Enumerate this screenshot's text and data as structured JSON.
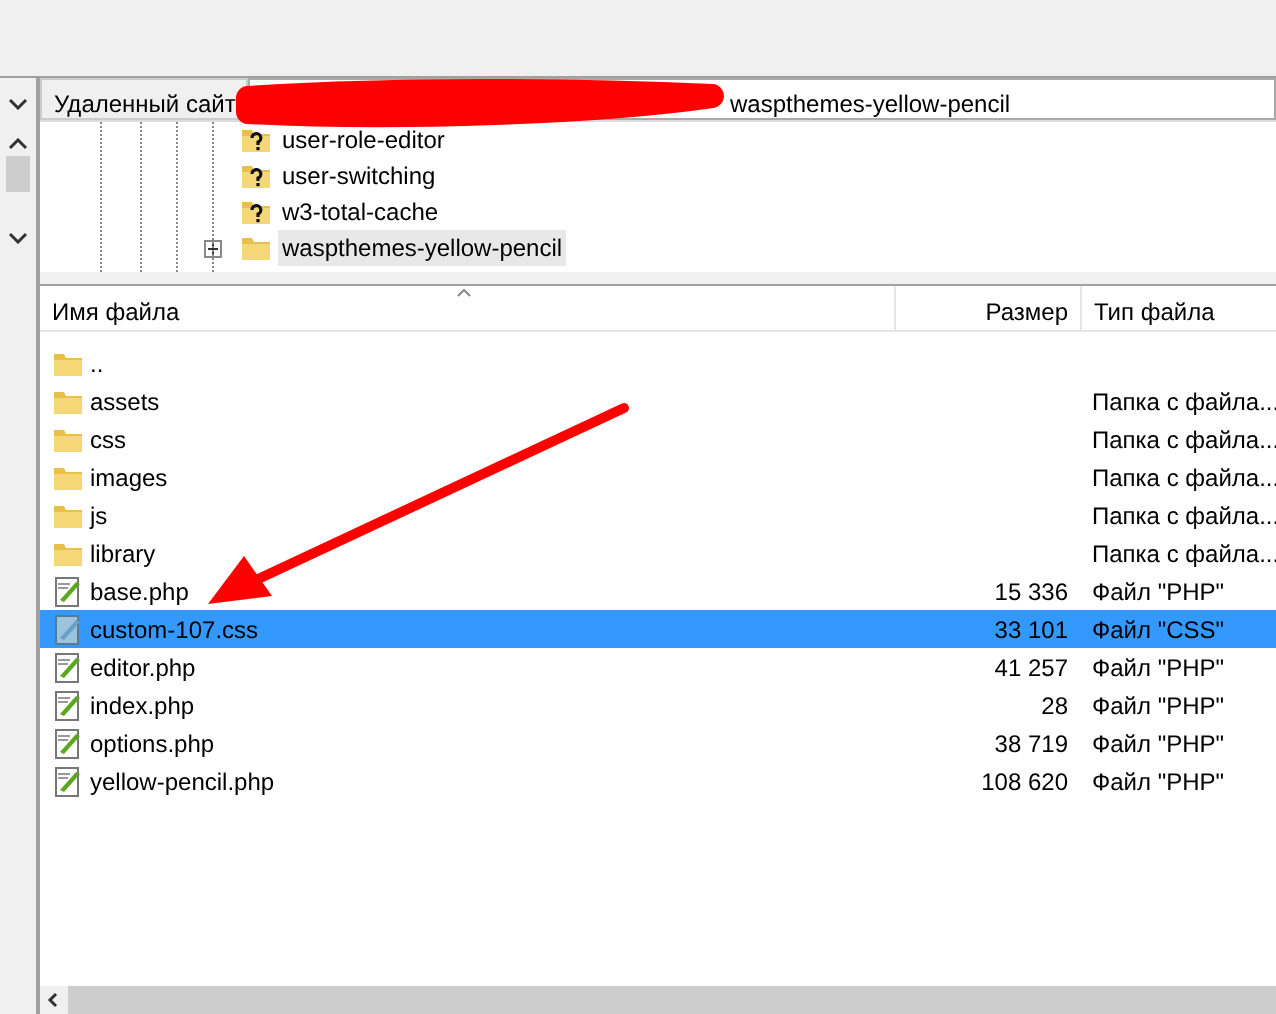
{
  "remote_site": {
    "label": "Удаленный сайт",
    "path": "waspthemes-yellow-pencil"
  },
  "tree": [
    {
      "name": "user-role-editor",
      "kind": "unknown",
      "expandable": false,
      "selected": false
    },
    {
      "name": "user-switching",
      "kind": "unknown",
      "expandable": false,
      "selected": false
    },
    {
      "name": "w3-total-cache",
      "kind": "unknown",
      "expandable": false,
      "selected": false
    },
    {
      "name": "waspthemes-yellow-pencil",
      "kind": "folder",
      "expandable": true,
      "selected": true
    }
  ],
  "file_list": {
    "columns": [
      "Имя файла",
      "Размер",
      "Тип файла"
    ],
    "rows": [
      {
        "name": "..",
        "kind": "folder",
        "size": "",
        "type": "",
        "selected": false
      },
      {
        "name": "assets",
        "kind": "folder",
        "size": "",
        "type": "Папка с файла...",
        "selected": false
      },
      {
        "name": "css",
        "kind": "folder",
        "size": "",
        "type": "Папка с файла...",
        "selected": false
      },
      {
        "name": "images",
        "kind": "folder",
        "size": "",
        "type": "Папка с файла...",
        "selected": false
      },
      {
        "name": "js",
        "kind": "folder",
        "size": "",
        "type": "Папка с файла...",
        "selected": false
      },
      {
        "name": "library",
        "kind": "folder",
        "size": "",
        "type": "Папка с файла...",
        "selected": false
      },
      {
        "name": "base.php",
        "kind": "php",
        "size": "15 336",
        "type": "Файл \"PHP\"",
        "selected": false
      },
      {
        "name": "custom-107.css",
        "kind": "css",
        "size": "33 101",
        "type": "Файл \"CSS\"",
        "selected": true
      },
      {
        "name": "editor.php",
        "kind": "php",
        "size": "41 257",
        "type": "Файл \"PHP\"",
        "selected": false
      },
      {
        "name": "index.php",
        "kind": "php",
        "size": "28",
        "type": "Файл \"PHP\"",
        "selected": false
      },
      {
        "name": "options.php",
        "kind": "php",
        "size": "38 719",
        "type": "Файл \"PHP\"",
        "selected": false
      },
      {
        "name": "yellow-pencil.php",
        "kind": "php",
        "size": "108 620",
        "type": "Файл \"PHP\"",
        "selected": false
      }
    ]
  },
  "annotations": {
    "redaction": true,
    "arrow": true
  }
}
